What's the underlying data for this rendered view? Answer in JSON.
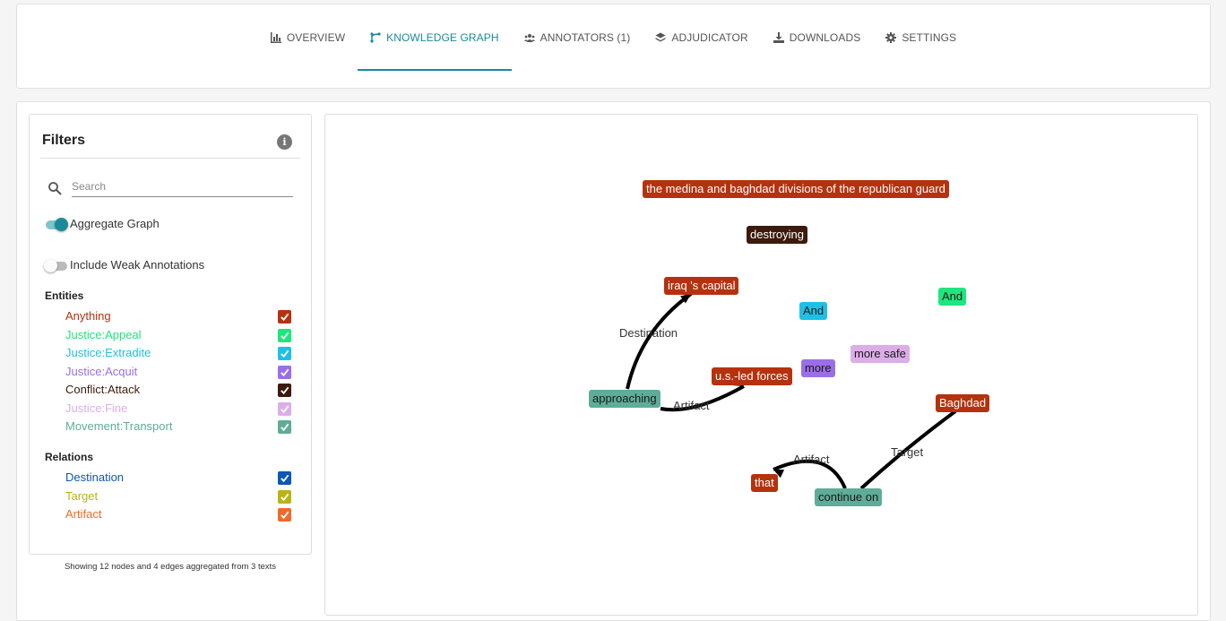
{
  "tabs": [
    {
      "label": "OVERVIEW",
      "icon": "bar-chart-icon",
      "active": false
    },
    {
      "label": "KNOWLEDGE GRAPH",
      "icon": "graph-icon",
      "active": true
    },
    {
      "label": "ANNOTATORS (1)",
      "icon": "users-icon",
      "active": false
    },
    {
      "label": "ADJUDICATOR",
      "icon": "layers-icon",
      "active": false
    },
    {
      "label": "DOWNLOADS",
      "icon": "download-icon",
      "active": false
    },
    {
      "label": "SETTINGS",
      "icon": "gear-icon",
      "active": false
    }
  ],
  "filters": {
    "title": "Filters",
    "search_placeholder": "Search",
    "aggregate_label": "Aggregate Graph",
    "aggregate_on": true,
    "weak_label": "Include Weak Annotations",
    "weak_on": false,
    "entities_title": "Entities",
    "entities": [
      {
        "label": "Anything",
        "color": "#b5320f",
        "checked": true
      },
      {
        "label": "Justice:Appeal",
        "color": "#1ee67e",
        "checked": true
      },
      {
        "label": "Justice:Extradite",
        "color": "#1ec0e6",
        "checked": true
      },
      {
        "label": "Justice:Acquit",
        "color": "#9b6ee8",
        "checked": true
      },
      {
        "label": "Conflict:Attack",
        "color": "#3d1a0c",
        "checked": true
      },
      {
        "label": "Justice:Fine",
        "color": "#dcaee8",
        "checked": true
      },
      {
        "label": "Movement:Transport",
        "color": "#5fac98",
        "checked": true
      }
    ],
    "relations_title": "Relations",
    "relations": [
      {
        "label": "Destination",
        "color": "#0c57b8",
        "checked": true
      },
      {
        "label": "Target",
        "color": "#b8b414",
        "checked": true
      },
      {
        "label": "Artifact",
        "color": "#f06a2b",
        "checked": true
      }
    ]
  },
  "footnote": "Showing 12 nodes and 4 edges aggregated from 3 texts",
  "graph": {
    "nodes": [
      {
        "id": "medina",
        "label": "the medina and baghdad divisions of the republican guard",
        "bg": "#b5320f",
        "fg": "#ffffff"
      },
      {
        "id": "destroying",
        "label": "destroying",
        "bg": "#3d1a0c",
        "fg": "#ffffff"
      },
      {
        "id": "capital",
        "label": "iraq 's capital",
        "bg": "#b5320f",
        "fg": "#ffffff"
      },
      {
        "id": "and1",
        "label": "And",
        "bg": "#1ec0e6",
        "fg": "#1a1a1a"
      },
      {
        "id": "and2",
        "label": "And",
        "bg": "#1ee67e",
        "fg": "#1a1a1a"
      },
      {
        "id": "moresafe",
        "label": "more safe",
        "bg": "#dcaee8",
        "fg": "#1a1a1a"
      },
      {
        "id": "more",
        "label": "more",
        "bg": "#9b6ee8",
        "fg": "#1a1a1a"
      },
      {
        "id": "usled",
        "label": "u.s.-led forces",
        "bg": "#b5320f",
        "fg": "#ffffff"
      },
      {
        "id": "approaching",
        "label": "approaching",
        "bg": "#5fac98",
        "fg": "#1a1a1a"
      },
      {
        "id": "baghdad",
        "label": "Baghdad",
        "bg": "#b5320f",
        "fg": "#ffffff"
      },
      {
        "id": "that",
        "label": "that",
        "bg": "#b5320f",
        "fg": "#ffffff"
      },
      {
        "id": "continue",
        "label": "continue on",
        "bg": "#5fac98",
        "fg": "#1a1a1a"
      }
    ],
    "edges": [
      {
        "id": "e1",
        "label": "Destination",
        "from": "approaching",
        "to": "capital"
      },
      {
        "id": "e2",
        "label": "Artifact",
        "from": "approaching",
        "to": "usled"
      },
      {
        "id": "e3",
        "label": "Target",
        "from": "continue",
        "to": "baghdad"
      },
      {
        "id": "e4",
        "label": "Artifact",
        "from": "continue",
        "to": "that"
      }
    ]
  }
}
